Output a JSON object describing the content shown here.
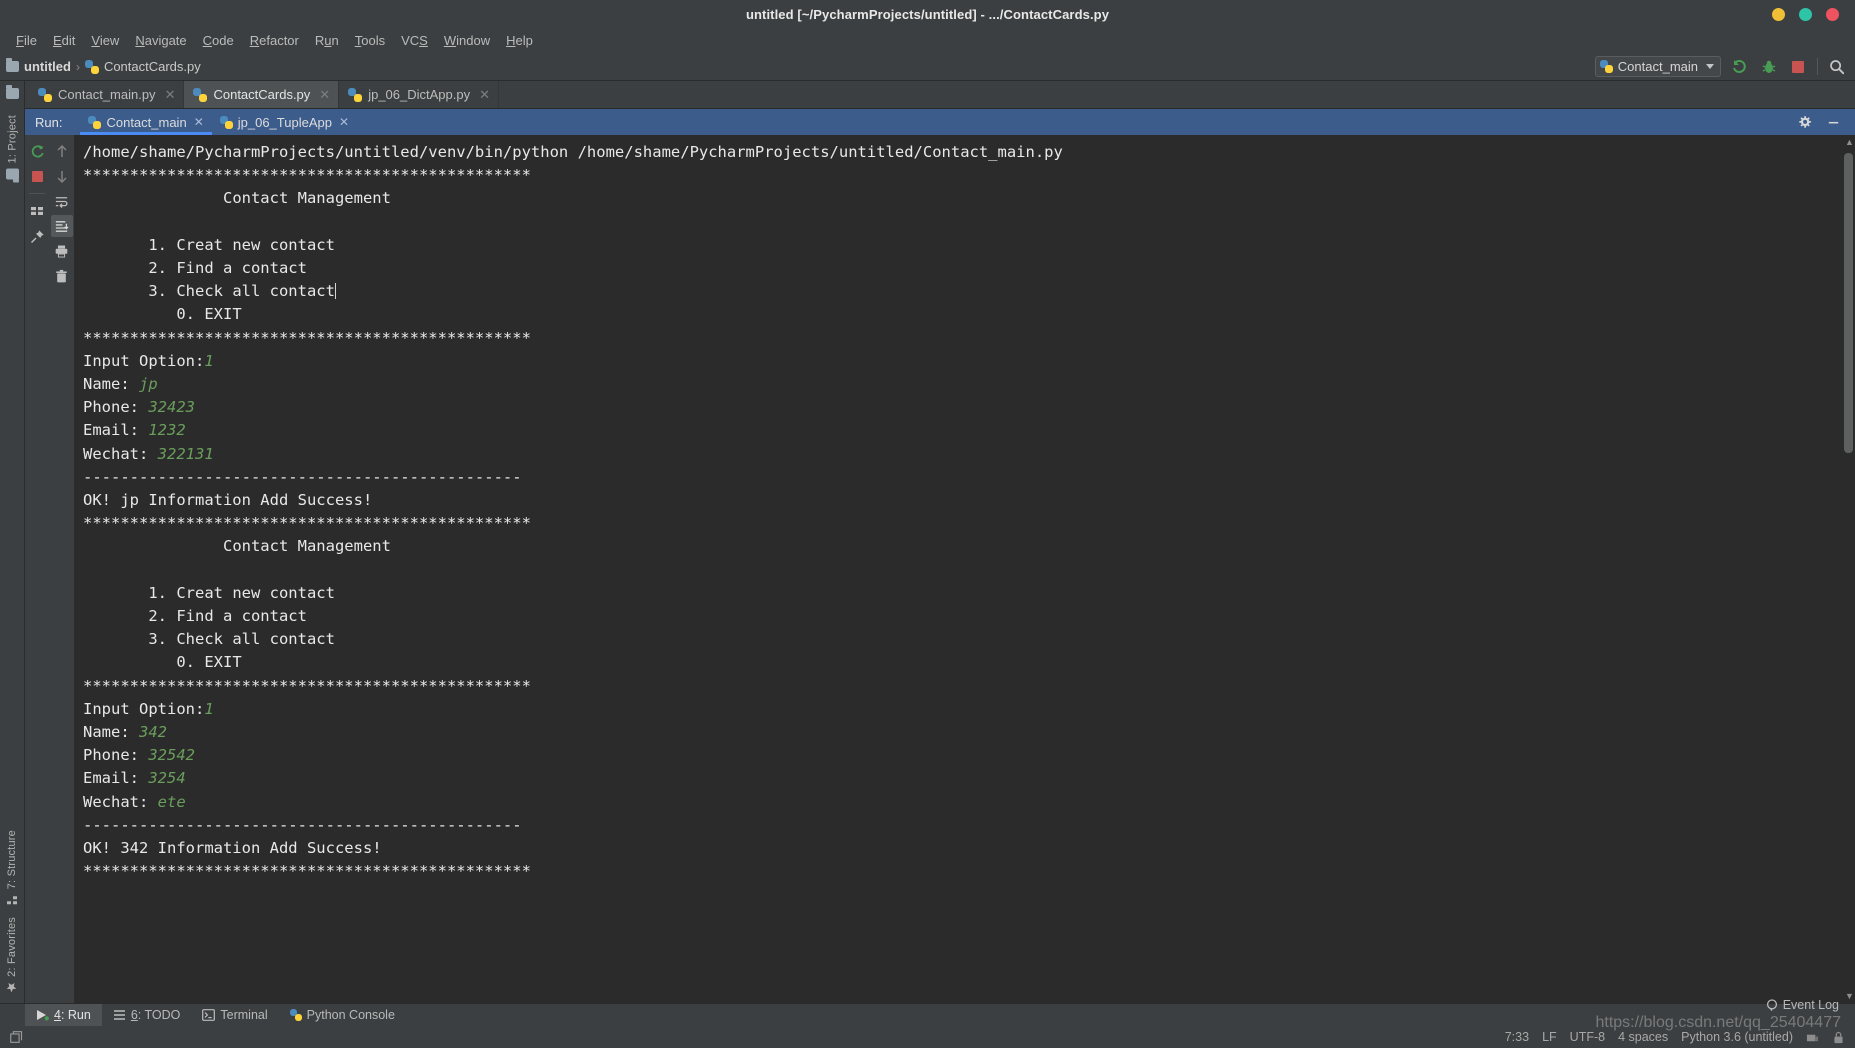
{
  "window": {
    "title": "untitled [~/PycharmProjects/untitled] - .../ContactCards.py",
    "controls": [
      {
        "name": "minimize",
        "color": "#f0bf35"
      },
      {
        "name": "maximize",
        "color": "#2ec4a6"
      },
      {
        "name": "close",
        "color": "#ef5360"
      }
    ]
  },
  "menubar": {
    "items": [
      {
        "label": "File",
        "mnemonic": "F"
      },
      {
        "label": "Edit",
        "mnemonic": "E"
      },
      {
        "label": "View",
        "mnemonic": "V"
      },
      {
        "label": "Navigate",
        "mnemonic": "N"
      },
      {
        "label": "Code",
        "mnemonic": "C"
      },
      {
        "label": "Refactor",
        "mnemonic": "R"
      },
      {
        "label": "Run",
        "mnemonic": "u"
      },
      {
        "label": "Tools",
        "mnemonic": "T"
      },
      {
        "label": "VCS",
        "mnemonic": "S"
      },
      {
        "label": "Window",
        "mnemonic": "W"
      },
      {
        "label": "Help",
        "mnemonic": "H"
      }
    ]
  },
  "toolbar": {
    "breadcrumbs": [
      {
        "label": "untitled",
        "icon": "folder-icon"
      },
      {
        "label": "ContactCards.py",
        "icon": "python-file-icon"
      }
    ],
    "separator": "›",
    "run_config": "Contact_main",
    "actions": [
      {
        "name": "run-button",
        "glyph": "run"
      },
      {
        "name": "debug-button",
        "glyph": "bug"
      },
      {
        "name": "stop-button",
        "glyph": "stop"
      },
      {
        "name": "search-everywhere-button",
        "glyph": "search"
      }
    ]
  },
  "left_rail": {
    "top": [
      {
        "label": "1: Project",
        "mnemonic": "1"
      }
    ],
    "bottom": [
      {
        "label": "7: Structure",
        "mnemonic": "7"
      },
      {
        "label": "2: Favorites",
        "mnemonic": "2"
      }
    ]
  },
  "editor_tabs": [
    {
      "label": "Contact_main.py",
      "active": false
    },
    {
      "label": "ContactCards.py",
      "active": true
    },
    {
      "label": "jp_06_DictApp.py",
      "active": false
    }
  ],
  "run_window": {
    "label": "Run:",
    "tabs": [
      {
        "label": "Contact_main",
        "active": true
      },
      {
        "label": "jp_06_TupleApp",
        "active": false
      }
    ],
    "header_actions": [
      {
        "name": "settings-gear-icon"
      },
      {
        "name": "hide-window-icon"
      }
    ],
    "gutter_left": [
      {
        "name": "rerun-icon"
      },
      {
        "name": "stop-icon"
      },
      {
        "name": "layout-icon"
      },
      {
        "name": "pin-icon"
      }
    ],
    "gutter_right": [
      {
        "name": "up-arrow-icon"
      },
      {
        "name": "down-arrow-icon"
      },
      {
        "name": "soft-wrap-icon"
      },
      {
        "name": "scroll-to-end-icon"
      },
      {
        "name": "print-icon"
      },
      {
        "name": "trash-icon"
      }
    ],
    "console": {
      "command": "/home/shame/PycharmProjects/untitled/venv/bin/python /home/shame/PycharmProjects/untitled/Contact_main.py",
      "banner": "************************************************",
      "divider": "-----------------------------------------------",
      "menu_title": "Contact Management",
      "menu_options": [
        "1. Creat new contact",
        "2. Find a contact",
        "3. Check all contact",
        "0. EXIT"
      ],
      "sessions": [
        {
          "prompt_option": "Input Option:",
          "option_value": "1",
          "fields": [
            {
              "label": "Name: ",
              "value": "jp"
            },
            {
              "label": "Phone: ",
              "value": "32423"
            },
            {
              "label": "Email: ",
              "value": "1232"
            },
            {
              "label": "Wechat: ",
              "value": "322131"
            }
          ],
          "result": "OK! jp Information Add Success!"
        },
        {
          "prompt_option": "Input Option:",
          "option_value": "1",
          "fields": [
            {
              "label": "Name: ",
              "value": "342"
            },
            {
              "label": "Phone: ",
              "value": "32542"
            },
            {
              "label": "Email: ",
              "value": "3254"
            },
            {
              "label": "Wechat: ",
              "value": "ete"
            }
          ],
          "result": "OK! 342 Information Add Success!"
        }
      ]
    }
  },
  "statusbar": {
    "tools": [
      {
        "label": "4: Run",
        "mnemonic": "4",
        "active": true,
        "icon": "run-icon"
      },
      {
        "label": "6: TODO",
        "mnemonic": "6",
        "active": false,
        "icon": "todo-icon"
      },
      {
        "label": "Terminal",
        "mnemonic": "",
        "active": false,
        "icon": "terminal-icon"
      },
      {
        "label": "Python Console",
        "mnemonic": "",
        "active": false,
        "icon": "python-console-icon"
      }
    ],
    "event_log": "Event Log",
    "caret_position": "7:33",
    "line_separator": "LF",
    "encoding": "UTF-8",
    "indent": "4 spaces",
    "interpreter": "Python 3.6 (untitled)",
    "watermark": "https://blog.csdn.net/qq_25404477"
  }
}
